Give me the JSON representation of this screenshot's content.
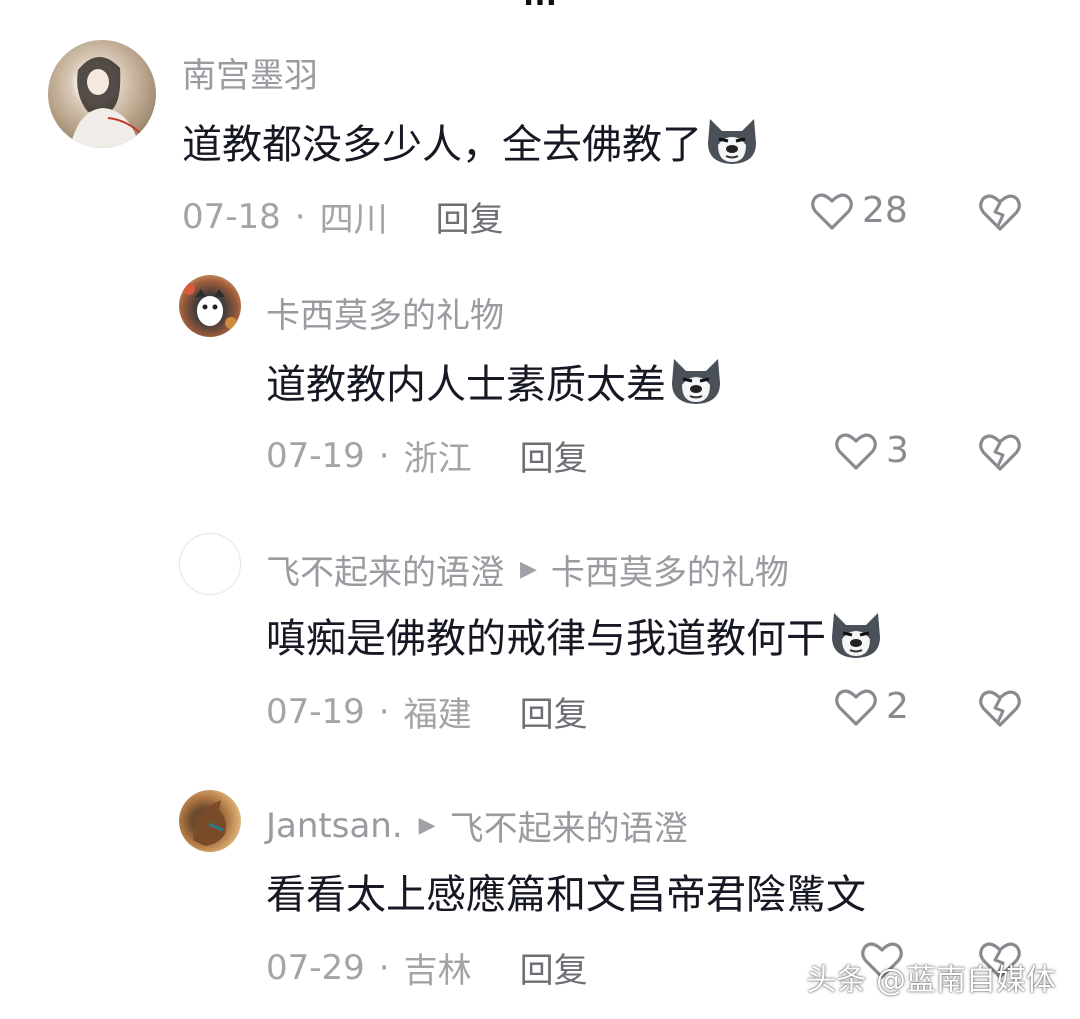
{
  "page_title": "...",
  "comments": [
    {
      "username": "南宫墨羽",
      "reply_to": "",
      "text": "道教都没多少人，全去佛教了",
      "emoji": "husky-dog-emoji",
      "date": "07-18",
      "location": "四川",
      "reply_label": "回复",
      "likes": "28"
    },
    {
      "username": "卡西莫多的礼物",
      "reply_to": "",
      "text": "道教教内人士素质太差",
      "emoji": "husky-dog-emoji",
      "date": "07-19",
      "location": "浙江",
      "reply_label": "回复",
      "likes": "3"
    },
    {
      "username": "飞不起来的语澄",
      "reply_to": "卡西莫多的礼物",
      "text": "嗔痴是佛教的戒律与我道教何干",
      "emoji": "husky-dog-emoji",
      "date": "07-19",
      "location": "福建",
      "reply_label": "回复",
      "likes": "2"
    },
    {
      "username": "Jantsan.",
      "reply_to": "飞不起来的语澄",
      "text": "看看太上感應篇和文昌帝君陰騭文",
      "emoji": "",
      "date": "07-29",
      "location": "吉林",
      "reply_label": "回复",
      "likes": ""
    }
  ],
  "separator_dot": "·",
  "watermark": "头条 @蓝南自媒体",
  "colors": {
    "text_primary": "#161823",
    "text_secondary": "#9a9aa0",
    "icon": "#8a8a90"
  }
}
